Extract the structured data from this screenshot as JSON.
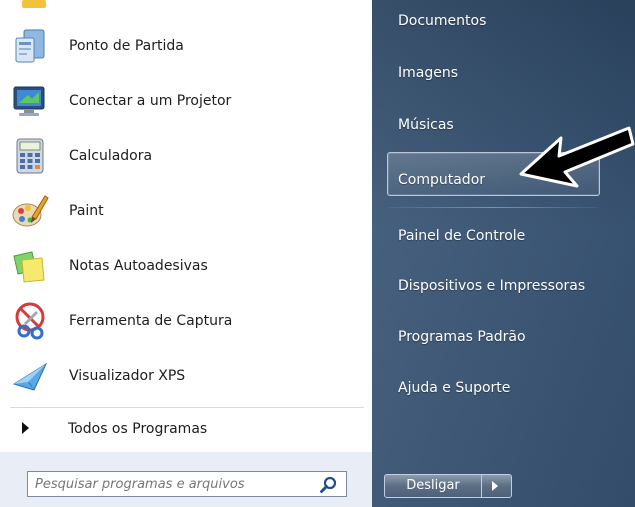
{
  "programs": [
    {
      "label": "Ponto de Partida",
      "icon": "getting-started-icon"
    },
    {
      "label": "Conectar a um Projetor",
      "icon": "projector-icon"
    },
    {
      "label": "Calculadora",
      "icon": "calculator-icon"
    },
    {
      "label": "Paint",
      "icon": "paint-icon"
    },
    {
      "label": "Notas Autoadesivas",
      "icon": "sticky-notes-icon"
    },
    {
      "label": "Ferramenta de Captura",
      "icon": "snipping-tool-icon"
    },
    {
      "label": "Visualizador XPS",
      "icon": "xps-viewer-icon"
    }
  ],
  "all_programs": "Todos os Programas",
  "search": {
    "placeholder": "Pesquisar programas e arquivos"
  },
  "right_panel": {
    "items": [
      "Documentos",
      "Imagens",
      "Músicas",
      "Computador",
      "Painel de Controle",
      "Dispositivos e Impressoras",
      "Programas Padrão",
      "Ajuda e Suporte"
    ],
    "highlighted": "Computador"
  },
  "shutdown": {
    "label": "Desligar"
  },
  "colors": {
    "right_panel_top": "#2b4460",
    "right_panel_bottom": "#35506f",
    "search_band": "#e9eef6"
  }
}
